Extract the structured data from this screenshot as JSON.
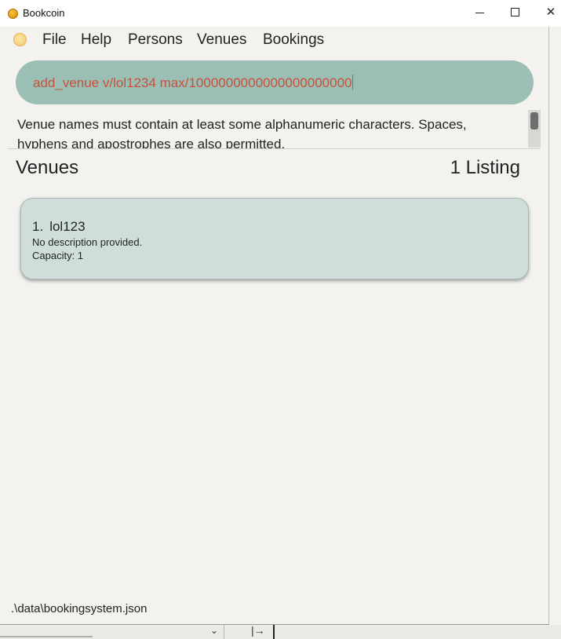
{
  "window": {
    "title": "Bookcoin"
  },
  "window_controls": {
    "minimize": "",
    "maximize": "",
    "close": "✕"
  },
  "menu": [
    "File",
    "Help",
    "Persons",
    "Venues",
    "Bookings"
  ],
  "command": {
    "value": "add_venue v/lol1234 max/1000000000000000000000"
  },
  "result": {
    "text": "Venue names must contain at least some alphanumeric characters. Spaces, hyphens and apostrophes are also permitted."
  },
  "list": {
    "title": "Venues",
    "count_label": "1 Listing",
    "items": [
      {
        "index": "1.",
        "name": "lol123",
        "description": "No description provided.",
        "capacity": "Capacity: 1"
      }
    ]
  },
  "status": {
    "path": ".\\data\\bookingsystem.json"
  },
  "colors": {
    "command_bg": "#9bbfb4",
    "command_text": "#c9513b",
    "card_bg": "#cfdeda",
    "window_bg": "#f4f2ee"
  }
}
